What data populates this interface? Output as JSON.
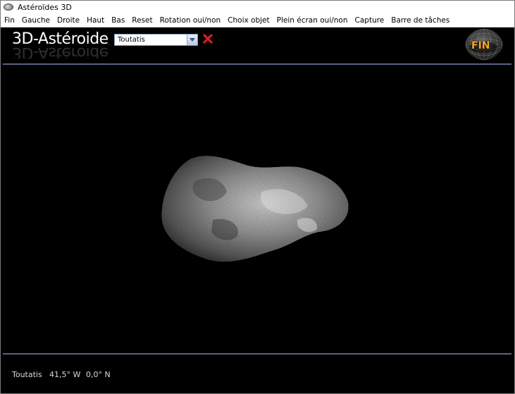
{
  "window": {
    "title": "Astéroïdes 3D"
  },
  "menu": {
    "items": [
      "Fin",
      "Gauche",
      "Droite",
      "Haut",
      "Bas",
      "Reset",
      "Rotation oui/non",
      "Choix objet",
      "Plein écran oui/non",
      "Capture",
      "Barre de tâches"
    ]
  },
  "header": {
    "brand": "3D-Astéroide",
    "object_select": {
      "selected": "Toutatis"
    },
    "fin_label": "FIN"
  },
  "status": {
    "object": "Toutatis",
    "longitude": "41,5° W",
    "latitude": "0,0° N"
  },
  "colors": {
    "background": "#000000",
    "divider": "#5b6281",
    "close_red": "#d62020",
    "fin_orange": "#f5a623"
  },
  "icons": {
    "app": "asteroid-icon",
    "dropdown": "chevron-down-icon",
    "close": "close-icon",
    "fin": "fin-globe-icon"
  }
}
